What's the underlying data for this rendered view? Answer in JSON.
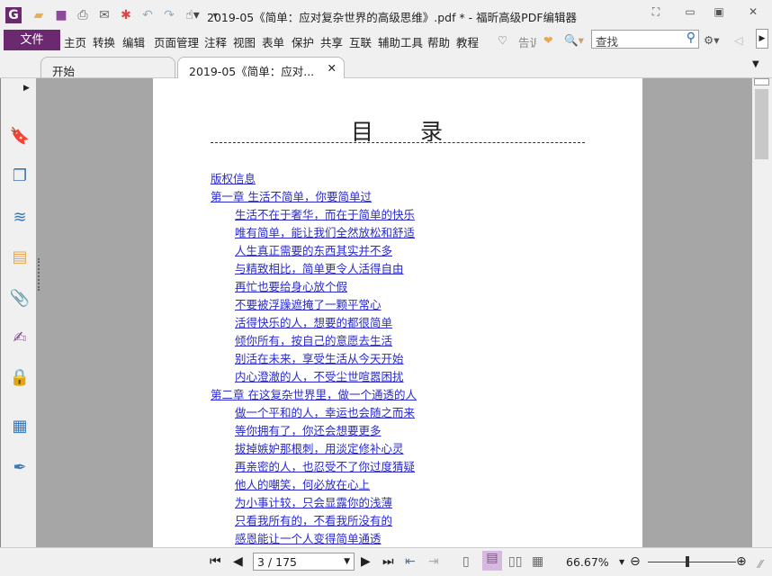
{
  "window": {
    "title": "2019-05《简单：应对复杂世界的高级思维》.pdf * - 福昕高级PDF编辑器"
  },
  "menu": {
    "file": "文件",
    "items": [
      "主页",
      "转换",
      "编辑",
      "页面管理",
      "注释",
      "视图",
      "表单",
      "保护",
      "共享",
      "互联",
      "辅助工具",
      "帮助",
      "教程"
    ],
    "tell_me": "告诉",
    "search_placeholder": "查找"
  },
  "tabs": [
    {
      "label": "开始"
    },
    {
      "label": "2019-05《简单：应对..."
    }
  ],
  "document": {
    "toc_title": "目 录",
    "entries": [
      {
        "level": 0,
        "text": "版权信息"
      },
      {
        "level": 0,
        "text": "第一章 生活不简单，你要简单过"
      },
      {
        "level": 1,
        "text": "生活不在于奢华，而在于简单的快乐"
      },
      {
        "level": 1,
        "text": "唯有简单，能让我们全然放松和舒适"
      },
      {
        "level": 1,
        "text": "人生真正需要的东西其实并不多"
      },
      {
        "level": 1,
        "text": "与精致相比，简单更令人活得自由"
      },
      {
        "level": 1,
        "text": "再忙也要给身心放个假"
      },
      {
        "level": 1,
        "text": "不要被浮躁遮掩了一颗平常心"
      },
      {
        "level": 1,
        "text": "活得快乐的人，想要的都很简单"
      },
      {
        "level": 1,
        "text": "倾你所有，按自己的意愿去生活"
      },
      {
        "level": 1,
        "text": "别活在未来，享受生活从今天开始"
      },
      {
        "level": 1,
        "text": "内心澄澈的人，不受尘世喧嚣困扰"
      },
      {
        "level": 0,
        "text": "第二章 在这复杂世界里，做一个通透的人"
      },
      {
        "level": 1,
        "text": "做一个平和的人，幸运也会随之而来"
      },
      {
        "level": 1,
        "text": "等你拥有了，你还会想要更多"
      },
      {
        "level": 1,
        "text": "拔掉嫉妒那根刺，用淡定修补心灵"
      },
      {
        "level": 1,
        "text": "再亲密的人，也忍受不了你过度猜疑"
      },
      {
        "level": 1,
        "text": "他人的嘲笑，何必放在心上"
      },
      {
        "level": 1,
        "text": "为小事计较，只会显露你的浅薄"
      },
      {
        "level": 1,
        "text": "只看我所有的，不看我所没有的"
      },
      {
        "level": 1,
        "text": "感恩能让一个人变得简单通透"
      }
    ]
  },
  "status": {
    "page": "3 / 175",
    "zoom": "66.67%",
    "zoom_fraction": 0.45
  },
  "colors": {
    "accent": "#6b2a70",
    "link": "#2a2ad0"
  }
}
